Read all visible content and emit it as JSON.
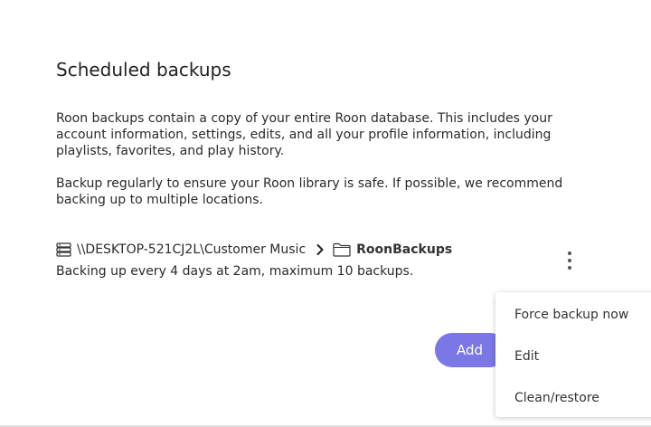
{
  "dialog": {
    "title": "Scheduled backups",
    "description_1": "Roon backups contain a copy of your entire Roon database. This includes your account information, settings, edits, and all your profile information, including playlists, favorites, and play history.",
    "description_2": "Backup regularly to ensure your Roon library is safe. If possible, we recommend backing up to multiple locations."
  },
  "backup": {
    "network_path": "\\\\DESKTOP-521CJ2L\\Customer Music",
    "folder": "RoonBackups",
    "schedule": "Backing up every 4 days at 2am, maximum 10 backups.",
    "icons": {
      "location": "server-icon",
      "separator": "chevron-right-icon",
      "folder": "folder-icon",
      "more": "more-vertical-icon"
    }
  },
  "actions": {
    "add_label": "Add",
    "accent_color": "#7b77e6"
  },
  "context_menu": {
    "items": [
      "Force backup now",
      "Edit",
      "Clean/restore"
    ]
  }
}
